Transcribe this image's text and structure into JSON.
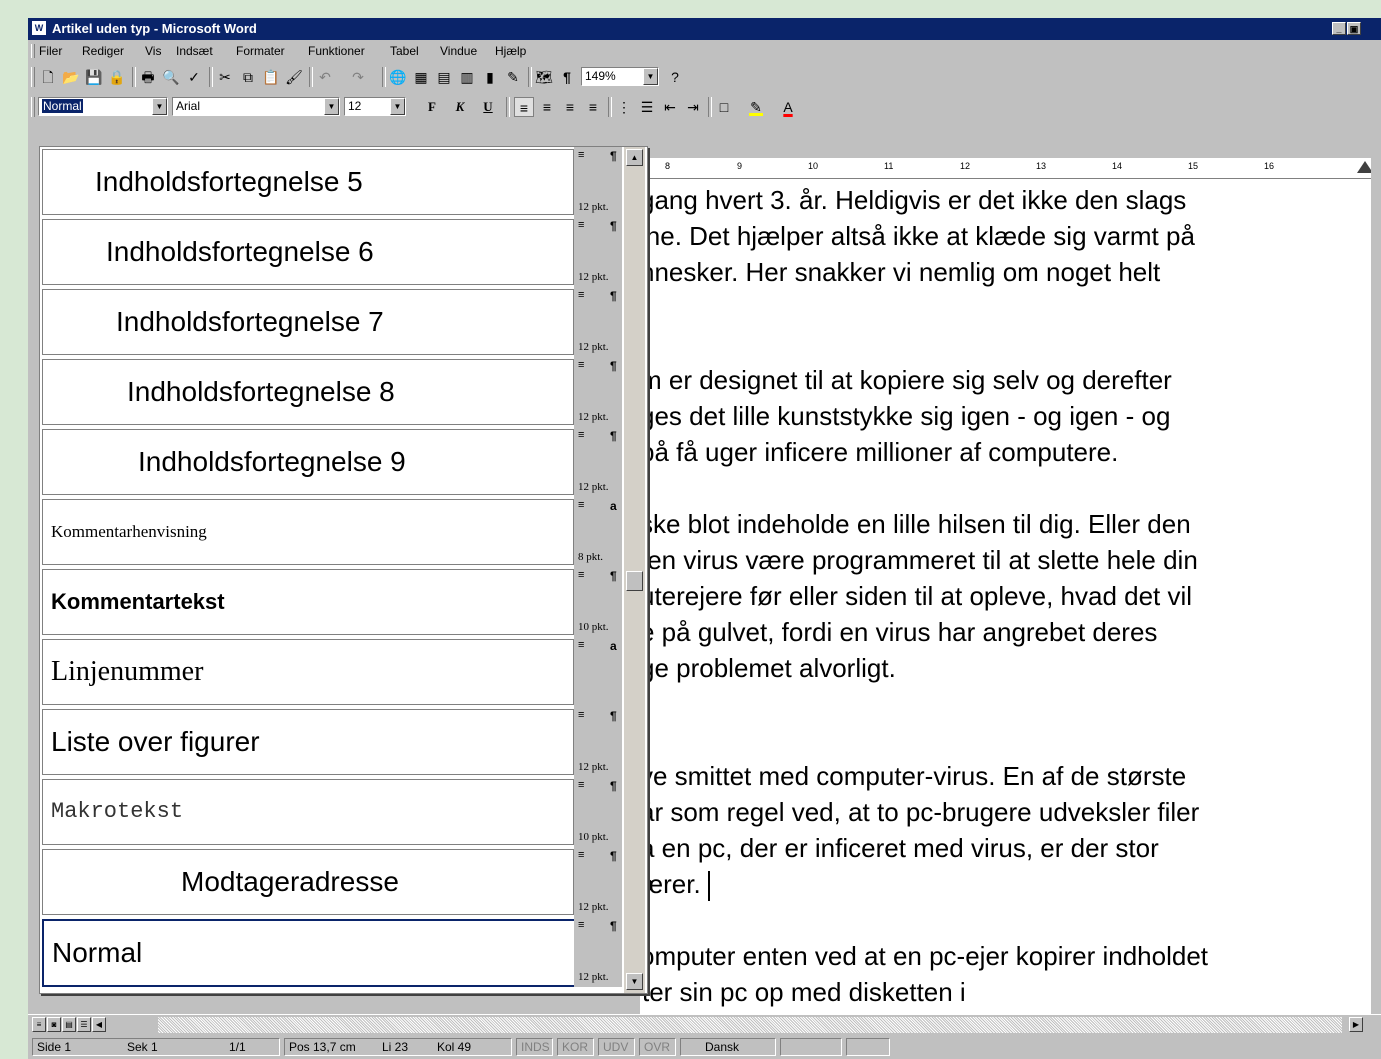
{
  "window": {
    "title": "Artikel uden typ - Microsoft Word",
    "icon_name": "word-app-icon",
    "minimize_glyph": "_",
    "maximize_glyph": "▣"
  },
  "menu": [
    "Filer",
    "Rediger",
    "Vis",
    "Indsæt",
    "Formater",
    "Funktioner",
    "Tabel",
    "Vindue",
    "Hjælp"
  ],
  "standard_toolbar": {
    "icons": [
      "new-icon",
      "open-icon",
      "save-icon",
      "permission-icon",
      "print-icon",
      "print-preview-icon",
      "spelling-icon",
      "cut-icon",
      "copy-icon",
      "paste-icon",
      "format-painter-icon",
      "undo-icon",
      "redo-icon",
      "hyperlink-icon",
      "tables-borders-icon",
      "insert-table-icon",
      "insert-excel-icon",
      "columns-icon",
      "drawing-icon",
      "document-map-icon",
      "show-formatting-icon",
      "help-icon"
    ],
    "zoom": "149%"
  },
  "formatting_toolbar": {
    "style": "Normal",
    "font": "Arial",
    "size": "12",
    "bold": "F",
    "italic": "K",
    "underline": "U",
    "highlight_color": "#ffff00",
    "font_color": "#ff0000"
  },
  "ruler": {
    "numbers": [
      "8",
      "9",
      "10",
      "11",
      "12",
      "13",
      "14",
      "15",
      "16"
    ]
  },
  "document": {
    "lines": [
      "gang hvert 3. år. Heldigvis er det ikke den slags",
      "ine. Det hjælper altså ikke at klæde sig varmt på",
      "nnesker. Her snakker vi nemlig om noget helt",
      "",
      "",
      "m er designet til at kopiere sig selv og derefter",
      "ges det lille kunststykke sig igen - og igen - og",
      "på få uger inficere millioner af computere.",
      "",
      "ske blot indeholde en lille hilsen til dig. Eller den",
      " en virus være programmeret til at slette hele din",
      "uterejere før eller siden til at opleve, hvad det vil",
      "e på gulvet, fordi en virus har angrebet deres",
      "ge problemet alvorligt.",
      "",
      "",
      "ve smittet med computer-virus. En af de største",
      "år som regel ved, at to pc-brugere udveksler filer",
      "a en pc, der er inficeret med virus, er der stor",
      "ærer.",
      "",
      "omputer enten ved at en pc-ejer kopirer indholdet",
      "  direkte ned på sin harddisk, eller ved at han starter sin pc op med disketten i"
    ]
  },
  "style_gallery": {
    "items": [
      {
        "name": "Indholdsfortegnelse 5",
        "size": "12 pkt.",
        "type": "¶",
        "align_icon": "align-left-icon"
      },
      {
        "name": "Indholdsfortegnelse 6",
        "size": "12 pkt.",
        "type": "¶",
        "align_icon": "align-left-icon"
      },
      {
        "name": "Indholdsfortegnelse 7",
        "size": "12 pkt.",
        "type": "¶",
        "align_icon": "align-left-icon"
      },
      {
        "name": "Indholdsfortegnelse 8",
        "size": "12 pkt.",
        "type": "¶",
        "align_icon": "align-left-icon"
      },
      {
        "name": "Indholdsfortegnelse 9",
        "size": "12 pkt.",
        "type": "¶",
        "align_icon": "align-left-icon"
      },
      {
        "name": "Kommentarhenvisning",
        "size": "8 pkt.",
        "type": "a",
        "align_icon": "align-left-icon"
      },
      {
        "name": "Kommentartekst",
        "size": "10 pkt.",
        "type": "¶",
        "align_icon": "align-left-icon"
      },
      {
        "name": "Linjenummer",
        "size": "",
        "type": "a",
        "align_icon": "align-left-icon"
      },
      {
        "name": "Liste over figurer",
        "size": "12 pkt.",
        "type": "¶",
        "align_icon": "align-left-icon"
      },
      {
        "name": "Makrotekst",
        "size": "10 pkt.",
        "type": "¶",
        "align_icon": "align-left-icon"
      },
      {
        "name": "Modtageradresse",
        "size": "12 pkt.",
        "type": "¶",
        "align_icon": "align-left-icon"
      },
      {
        "name": "Normal",
        "size": "12 pkt.",
        "type": "¶",
        "align_icon": "align-left-icon",
        "selected": true
      }
    ]
  },
  "status_bar": {
    "page": "Side 1",
    "section": "Sek 1",
    "page_of": "1/1",
    "position": "Pos 13,7 cm",
    "line": "Li 23",
    "column": "Kol 49",
    "modes": [
      "INDS",
      "KOR",
      "UDV",
      "OVR"
    ],
    "language": "Dansk"
  }
}
